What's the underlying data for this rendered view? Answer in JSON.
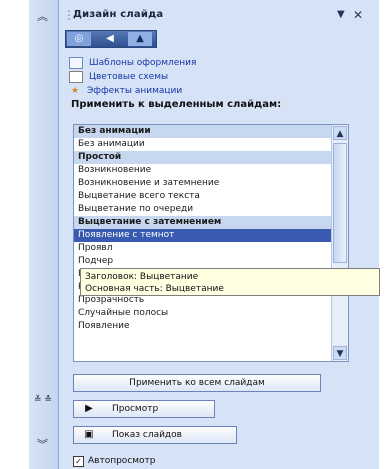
{
  "pane": {
    "title": "Дизайн слайда",
    "menu_glyph": "▼",
    "close_glyph": "✕"
  },
  "nav": {
    "home_glyph": "◎",
    "back_glyph": "◀",
    "fwd_glyph": "▲"
  },
  "links": [
    {
      "label": "Шаблоны оформления",
      "icon": "design-template-icon"
    },
    {
      "label": "Цветовые схемы",
      "icon": "color-scheme-icon"
    },
    {
      "label": "Эффекты анимации",
      "icon": "animation-star-icon"
    }
  ],
  "section_label": "Применить к выделенным слайдам:",
  "effects": [
    {
      "label": "Без анимации",
      "kind": "header"
    },
    {
      "label": "Без анимации",
      "kind": "item"
    },
    {
      "label": "Простой",
      "kind": "header"
    },
    {
      "label": "Возникновение",
      "kind": "item"
    },
    {
      "label": "Возникновение и затемнение",
      "kind": "item"
    },
    {
      "label": "Выцветание всего текста",
      "kind": "item"
    },
    {
      "label": "Выцветание по очереди",
      "kind": "item"
    },
    {
      "label": "Выцветание с затемнением",
      "kind": "header"
    },
    {
      "label": "Появление с темнот",
      "kind": "selected"
    },
    {
      "label": "Проявл",
      "kind": "item"
    },
    {
      "label": "Подчер",
      "kind": "item"
    },
    {
      "label": "Растворение",
      "kind": "item"
    },
    {
      "label": "Кратковременное расширение",
      "kind": "item"
    },
    {
      "label": "Прозрачность",
      "kind": "item"
    },
    {
      "label": "Случайные полосы",
      "kind": "item"
    },
    {
      "label": "Появление",
      "kind": "item"
    }
  ],
  "tooltip": {
    "line1": "Заголовок: Выцветание",
    "line2": "Основная часть: Выцветание"
  },
  "buttons": {
    "apply_all": "Применить ко всем слайдам",
    "preview": "Просмотр",
    "slideshow": "Показ слайдов"
  },
  "autopreview": {
    "label": "Автопросмотр",
    "checked": true
  },
  "outer_scroll": {
    "split_label": "≚ ≛"
  }
}
